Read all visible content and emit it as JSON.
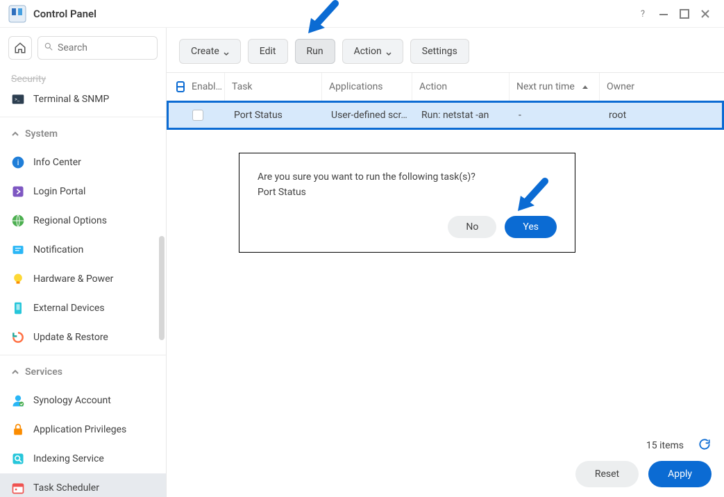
{
  "window": {
    "title": "Control Panel"
  },
  "sidebar": {
    "search_placeholder": "Search",
    "partial_item": "Security",
    "items_top": [
      {
        "label": "Terminal & SNMP",
        "icon": "terminal"
      }
    ],
    "section_system": "System",
    "items_system": [
      {
        "label": "Info Center",
        "icon": "info"
      },
      {
        "label": "Login Portal",
        "icon": "portal"
      },
      {
        "label": "Regional Options",
        "icon": "globe"
      },
      {
        "label": "Notification",
        "icon": "bell"
      },
      {
        "label": "Hardware & Power",
        "icon": "bulb"
      },
      {
        "label": "External Devices",
        "icon": "phone"
      },
      {
        "label": "Update & Restore",
        "icon": "restore"
      }
    ],
    "section_services": "Services",
    "items_services": [
      {
        "label": "Synology Account",
        "icon": "account"
      },
      {
        "label": "Application Privileges",
        "icon": "lock"
      },
      {
        "label": "Indexing Service",
        "icon": "indexing"
      },
      {
        "label": "Task Scheduler",
        "icon": "calendar"
      }
    ]
  },
  "toolbar": {
    "create": "Create",
    "edit": "Edit",
    "run": "Run",
    "action": "Action",
    "settings": "Settings"
  },
  "table": {
    "headers": {
      "enabled": "Enabl…",
      "task": "Task",
      "apps": "Applications",
      "action": "Action",
      "next": "Next run time",
      "owner": "Owner"
    },
    "rows": [
      {
        "task": "Port Status",
        "apps": "User-defined scr…",
        "action": "Run: netstat -an",
        "next": "-",
        "owner": "root"
      }
    ],
    "items_label": "15 items"
  },
  "dialog": {
    "question": "Are you sure you want to run the following task(s)?",
    "task_name": "Port Status",
    "no": "No",
    "yes": "Yes"
  },
  "footer": {
    "reset": "Reset",
    "apply": "Apply"
  }
}
